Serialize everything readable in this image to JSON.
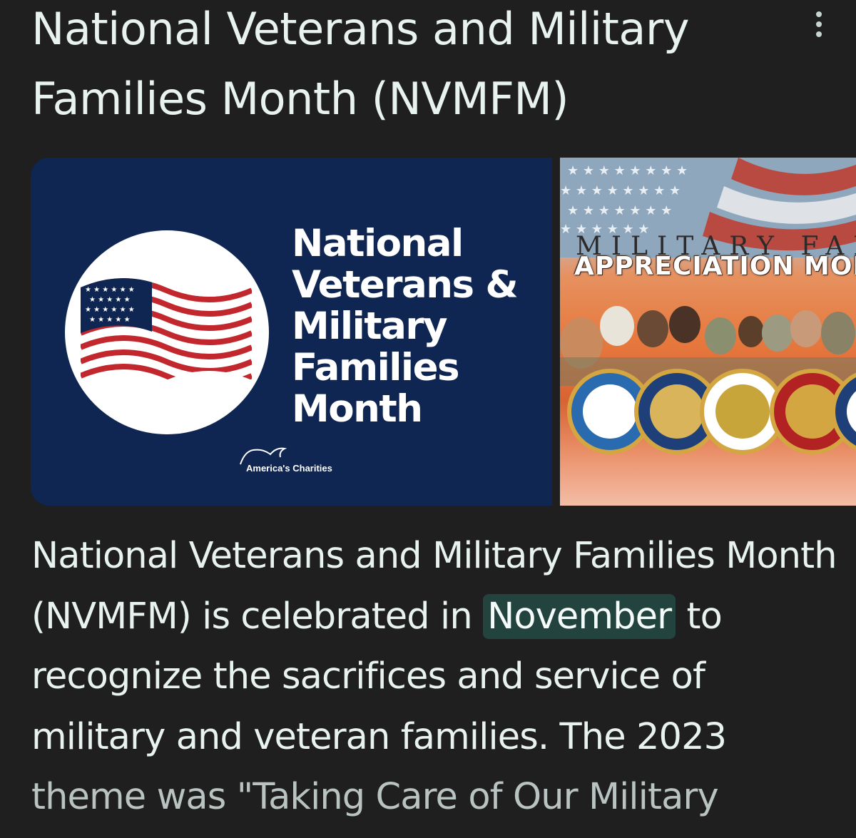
{
  "title": "National Veterans and Military Families Month (NVMFM)",
  "more_menu_icon": "more-vertical-icon",
  "images": {
    "left": {
      "text": "National\nVeterans &\nMilitary\nFamilies\nMonth",
      "logo_label": "America's Charities",
      "background_color": "#0f2552"
    },
    "right": {
      "banner_top": "MILITARY FAMI",
      "banner_bottom": "APPRECIATION MON"
    }
  },
  "description": {
    "text_before": "National Veterans and Military Families Month (NVMFM) is celebrated in ",
    "highlight": "November",
    "text_after": " to recognize the sacrifices and service of military and veteran families. The 2023",
    "text_faded": "theme was \"Taking Care of Our Military"
  },
  "colors": {
    "background": "#1f1f1f",
    "text": "#e8f2ef",
    "highlight_bg": "#23433e"
  }
}
